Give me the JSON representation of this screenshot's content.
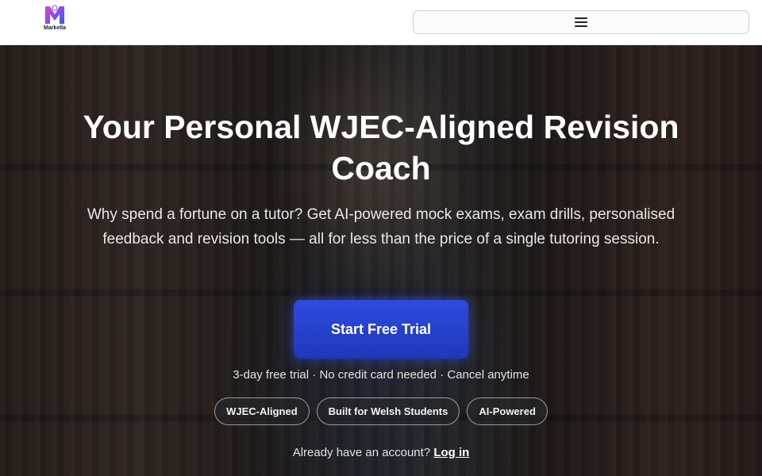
{
  "header": {
    "logo_text": "Markella",
    "menu_icon": "hamburger-icon",
    "brand_colors": [
      "#3b4bf0",
      "#c83ce0"
    ]
  },
  "hero": {
    "headline": "Your Personal WJEC-Aligned Revision Coach",
    "subtext": "Why spend a fortune on a tutor? Get AI-powered mock exams, exam drills, personalised feedback and revision tools — all for less than the price of a single tutoring session.",
    "cta_label": "Start Free Trial",
    "cta_color": "#2541d1",
    "trial_note": "3-day free trial · No credit card needed · Cancel anytime",
    "badges": [
      "WJEC-Aligned",
      "Built for Welsh Students",
      "AI-Powered"
    ],
    "login_prompt": "Already have an account?",
    "login_link": "Log in"
  }
}
